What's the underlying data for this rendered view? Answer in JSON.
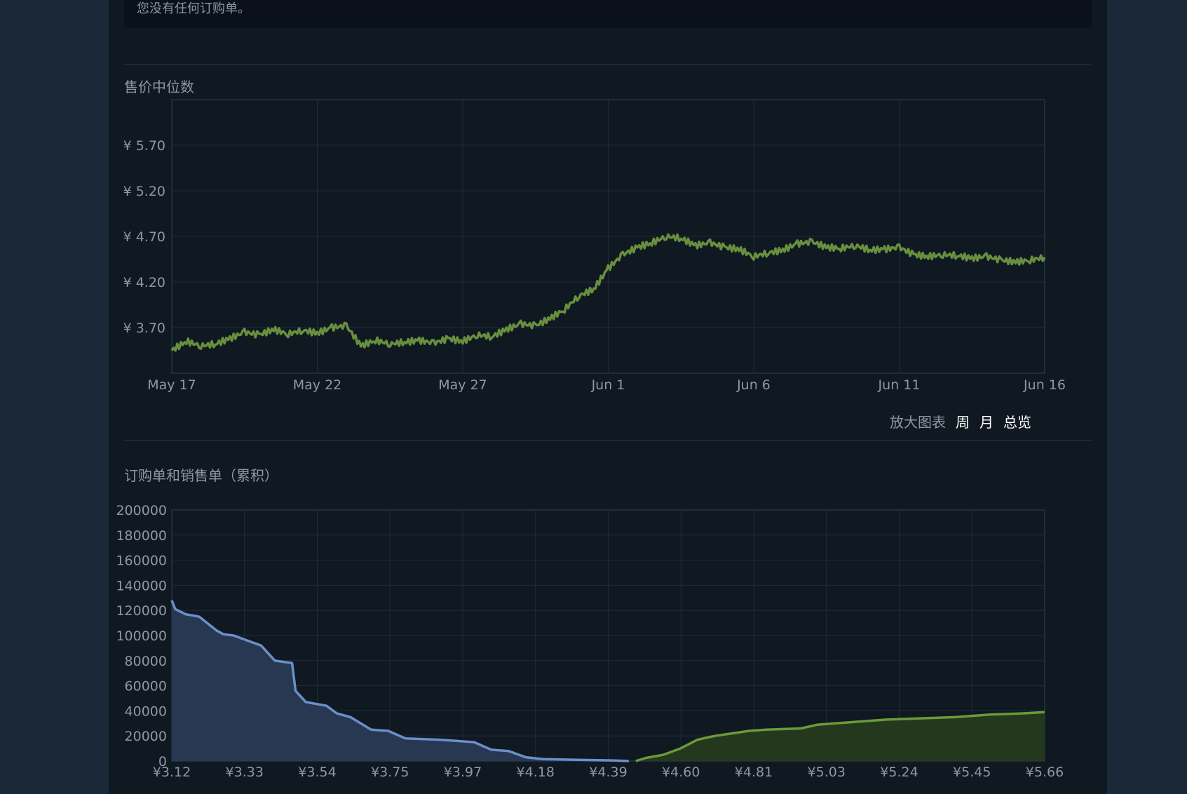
{
  "notice": "您没有任何订购单。",
  "median_title": "售价中位数",
  "orders_title": "订购单和销售单（累积）",
  "zoom": {
    "label": "放大图表",
    "week": "周",
    "month": "月",
    "all": "总览"
  },
  "colors": {
    "background": "#1b2838",
    "panel": "#101822",
    "grid": "#1f2d3b",
    "price_line": "#688f3e",
    "buy_line": "#6b8fc9",
    "buy_fill": "#2a3a55",
    "sell_line": "#6b9a3a",
    "sell_fill": "#263a1f",
    "axis_text": "#8f98a0"
  },
  "chart_data": [
    {
      "type": "line",
      "title": "售价中位数",
      "x_ticks": [
        "May 17",
        "May 22",
        "May 27",
        "Jun 1",
        "Jun 6",
        "Jun 11",
        "Jun 16"
      ],
      "y_ticks": [
        "¥ 3.70",
        "¥ 4.20",
        "¥ 4.70",
        "¥ 5.20",
        "¥ 5.70"
      ],
      "ylim": [
        3.2,
        6.2
      ],
      "xlim_days": [
        0,
        30
      ],
      "grid": true,
      "series": [
        {
          "x_days": [
            0,
            0.5,
            1,
            1.5,
            2,
            2.5,
            3,
            3.5,
            4,
            4.5,
            5,
            5.5,
            6,
            6.5,
            7,
            7.5,
            8,
            8.5,
            9,
            9.5,
            10,
            10.5,
            11,
            11.5,
            12,
            12.5,
            13,
            13.5,
            14,
            14.5,
            15,
            15.5,
            16,
            16.5,
            17,
            17.5,
            18,
            18.5,
            19,
            19.5,
            20,
            20.5,
            21,
            21.5,
            22,
            22.5,
            23,
            23.5,
            24,
            24.5,
            25,
            25.5,
            26,
            26.5,
            27,
            27.5,
            28,
            28.5,
            29,
            29.5,
            30
          ],
          "values": [
            3.45,
            3.55,
            3.5,
            3.52,
            3.58,
            3.65,
            3.62,
            3.68,
            3.63,
            3.67,
            3.64,
            3.7,
            3.72,
            3.5,
            3.56,
            3.52,
            3.54,
            3.56,
            3.53,
            3.58,
            3.55,
            3.62,
            3.6,
            3.68,
            3.74,
            3.72,
            3.8,
            3.9,
            4.05,
            4.12,
            4.35,
            4.5,
            4.58,
            4.63,
            4.7,
            4.68,
            4.6,
            4.63,
            4.58,
            4.56,
            4.48,
            4.52,
            4.55,
            4.62,
            4.64,
            4.58,
            4.57,
            4.6,
            4.55,
            4.56,
            4.58,
            4.5,
            4.48,
            4.5,
            4.49,
            4.46,
            4.48,
            4.44,
            4.42,
            4.44,
            4.47
          ]
        }
      ]
    },
    {
      "type": "area",
      "title": "订购单和销售单（累积）",
      "x_ticks": [
        "¥3.12",
        "¥3.33",
        "¥3.54",
        "¥3.75",
        "¥3.97",
        "¥4.18",
        "¥4.39",
        "¥4.60",
        "¥4.81",
        "¥5.03",
        "¥5.24",
        "¥5.45",
        "¥5.66"
      ],
      "y_ticks": [
        "0",
        "20000",
        "40000",
        "60000",
        "80000",
        "100000",
        "120000",
        "140000",
        "160000",
        "180000",
        "200000"
      ],
      "xlim": [
        3.12,
        5.66
      ],
      "ylim": [
        0,
        200000
      ],
      "grid": true,
      "series": [
        {
          "name": "buy",
          "x": [
            3.12,
            3.13,
            3.16,
            3.2,
            3.25,
            3.27,
            3.3,
            3.35,
            3.38,
            3.42,
            3.47,
            3.48,
            3.51,
            3.57,
            3.6,
            3.64,
            3.7,
            3.75,
            3.8,
            3.9,
            4.0,
            4.05,
            4.1,
            4.15,
            4.2,
            4.3,
            4.4,
            4.45
          ],
          "values": [
            128000,
            121000,
            117000,
            115000,
            104000,
            101000,
            100000,
            95000,
            92000,
            80000,
            78000,
            56000,
            47000,
            44000,
            38000,
            35000,
            25000,
            24000,
            18000,
            17000,
            15000,
            9000,
            8000,
            3000,
            1500,
            1000,
            500,
            0
          ]
        },
        {
          "name": "sell",
          "x": [
            4.47,
            4.5,
            4.55,
            4.6,
            4.65,
            4.7,
            4.75,
            4.8,
            4.85,
            4.95,
            5.0,
            5.1,
            5.2,
            5.3,
            5.4,
            5.5,
            5.6,
            5.66
          ],
          "values": [
            0,
            2500,
            5000,
            10000,
            17000,
            20000,
            22000,
            24000,
            25000,
            26000,
            29000,
            31000,
            33000,
            34000,
            35000,
            37000,
            38000,
            39000
          ]
        }
      ]
    }
  ]
}
